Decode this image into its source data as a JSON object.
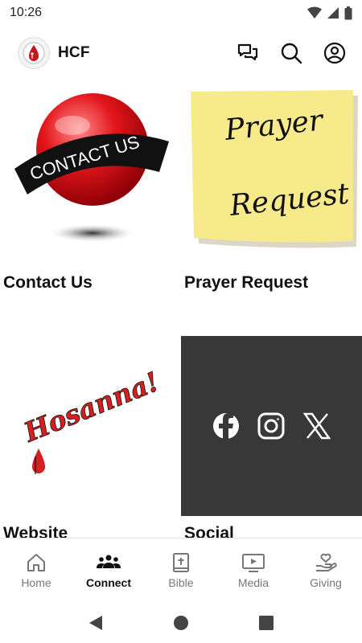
{
  "status_bar": {
    "time": "10:26"
  },
  "app_bar": {
    "title": "HCF"
  },
  "tiles": [
    {
      "label": "Contact Us",
      "image_text": "CONTACT US"
    },
    {
      "label": "Prayer Request",
      "image_text_line1": "Prayer",
      "image_text_line2": "Request"
    },
    {
      "label": "Website",
      "image_text": "Hosanna!"
    },
    {
      "label": "Social"
    }
  ],
  "bottom_nav": {
    "active": "Connect",
    "items": [
      {
        "label": "Home",
        "icon": "home-icon"
      },
      {
        "label": "Connect",
        "icon": "people-icon"
      },
      {
        "label": "Bible",
        "icon": "bible-icon"
      },
      {
        "label": "Media",
        "icon": "media-icon"
      },
      {
        "label": "Giving",
        "icon": "giving-icon"
      }
    ]
  },
  "colors": {
    "accent_red": "#d42020",
    "social_bg": "#383838",
    "sticky_note": "#f7ea8a"
  }
}
